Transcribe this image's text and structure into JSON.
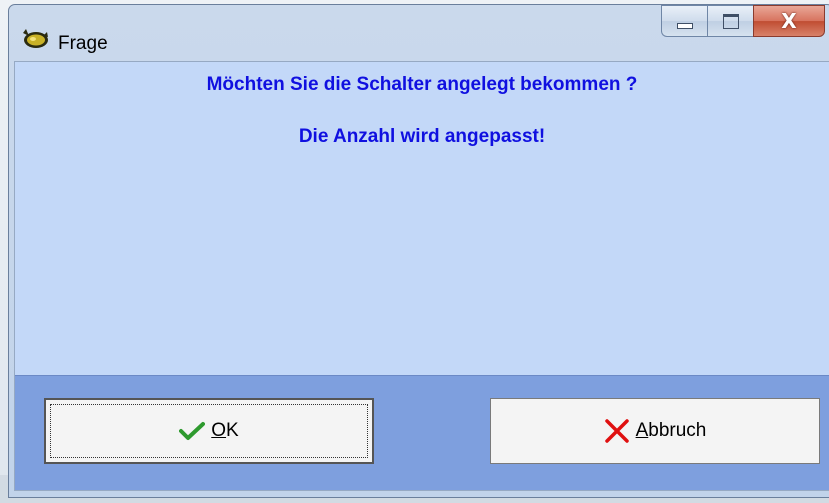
{
  "window": {
    "title": "Frage",
    "icon": "cat-app-icon"
  },
  "caption": {
    "minimize_icon": "minimize-icon",
    "maximize_icon": "maximize-icon",
    "close_icon": "close-icon",
    "close_glyph": "X"
  },
  "message": {
    "line1": "Möchten Sie die Schalter angelegt bekommen ?",
    "line2": "Die Anzahl wird angepasst!"
  },
  "buttons": {
    "ok": {
      "mnemonic": "O",
      "rest": "K",
      "icon": "checkmark-icon",
      "icon_color": "#2e9a2e"
    },
    "cancel": {
      "mnemonic": "A",
      "rest": "bbruch",
      "icon": "cross-icon",
      "icon_color": "#e01010"
    }
  },
  "colors": {
    "message_text": "#1010e0",
    "client_bg": "#c3d8f8",
    "button_bar_bg": "#7e9fde"
  }
}
